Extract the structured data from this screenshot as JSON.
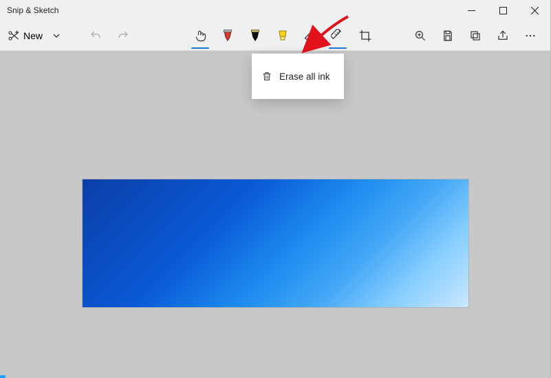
{
  "app": {
    "title": "Snip & Sketch"
  },
  "toolbar": {
    "new_label": "New",
    "menu": {
      "erase_all_label": "Erase all ink"
    }
  },
  "icons": {
    "new": "scissors-plus-icon",
    "chevron_down": "chevron-down-icon",
    "undo": "undo-icon",
    "redo": "redo-icon",
    "touch": "touch-writing-icon",
    "pen_red": "pen-red-icon",
    "pen_black": "pen-black-icon",
    "highlighter": "highlighter-yellow-icon",
    "eraser": "eraser-icon",
    "ruler": "ruler-icon",
    "crop": "crop-icon",
    "zoom": "zoom-icon",
    "save": "save-icon",
    "copy": "copy-icon",
    "share": "share-icon",
    "more": "more-icon",
    "trash": "trash-icon",
    "minimize": "window-minimize-icon",
    "maximize": "window-maximize-icon",
    "close": "window-close-icon"
  },
  "state": {
    "selected_tool": "touch",
    "ruler_selected": true,
    "eraser_menu_open": true
  }
}
